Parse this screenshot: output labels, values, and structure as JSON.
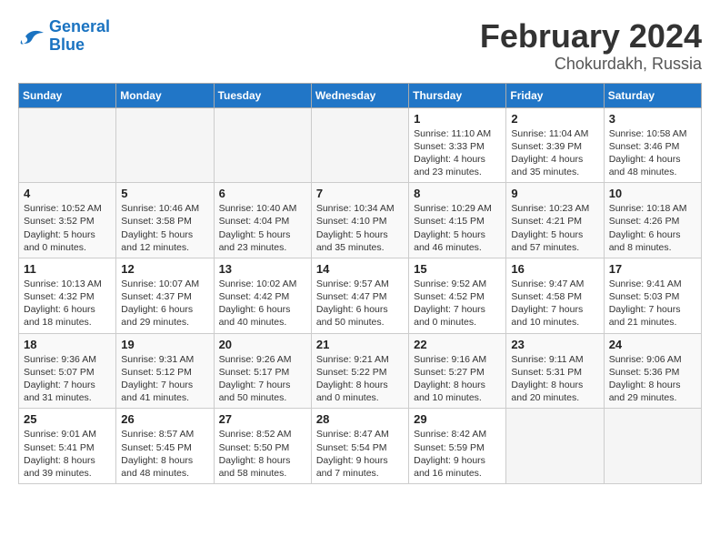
{
  "logo": {
    "line1": "General",
    "line2": "Blue"
  },
  "title": "February 2024",
  "location": "Chokurdakh, Russia",
  "weekdays": [
    "Sunday",
    "Monday",
    "Tuesday",
    "Wednesday",
    "Thursday",
    "Friday",
    "Saturday"
  ],
  "weeks": [
    [
      {
        "day": "",
        "info": ""
      },
      {
        "day": "",
        "info": ""
      },
      {
        "day": "",
        "info": ""
      },
      {
        "day": "",
        "info": ""
      },
      {
        "day": "1",
        "info": "Sunrise: 11:10 AM\nSunset: 3:33 PM\nDaylight: 4 hours\nand 23 minutes."
      },
      {
        "day": "2",
        "info": "Sunrise: 11:04 AM\nSunset: 3:39 PM\nDaylight: 4 hours\nand 35 minutes."
      },
      {
        "day": "3",
        "info": "Sunrise: 10:58 AM\nSunset: 3:46 PM\nDaylight: 4 hours\nand 48 minutes."
      }
    ],
    [
      {
        "day": "4",
        "info": "Sunrise: 10:52 AM\nSunset: 3:52 PM\nDaylight: 5 hours\nand 0 minutes."
      },
      {
        "day": "5",
        "info": "Sunrise: 10:46 AM\nSunset: 3:58 PM\nDaylight: 5 hours\nand 12 minutes."
      },
      {
        "day": "6",
        "info": "Sunrise: 10:40 AM\nSunset: 4:04 PM\nDaylight: 5 hours\nand 23 minutes."
      },
      {
        "day": "7",
        "info": "Sunrise: 10:34 AM\nSunset: 4:10 PM\nDaylight: 5 hours\nand 35 minutes."
      },
      {
        "day": "8",
        "info": "Sunrise: 10:29 AM\nSunset: 4:15 PM\nDaylight: 5 hours\nand 46 minutes."
      },
      {
        "day": "9",
        "info": "Sunrise: 10:23 AM\nSunset: 4:21 PM\nDaylight: 5 hours\nand 57 minutes."
      },
      {
        "day": "10",
        "info": "Sunrise: 10:18 AM\nSunset: 4:26 PM\nDaylight: 6 hours\nand 8 minutes."
      }
    ],
    [
      {
        "day": "11",
        "info": "Sunrise: 10:13 AM\nSunset: 4:32 PM\nDaylight: 6 hours\nand 18 minutes."
      },
      {
        "day": "12",
        "info": "Sunrise: 10:07 AM\nSunset: 4:37 PM\nDaylight: 6 hours\nand 29 minutes."
      },
      {
        "day": "13",
        "info": "Sunrise: 10:02 AM\nSunset: 4:42 PM\nDaylight: 6 hours\nand 40 minutes."
      },
      {
        "day": "14",
        "info": "Sunrise: 9:57 AM\nSunset: 4:47 PM\nDaylight: 6 hours\nand 50 minutes."
      },
      {
        "day": "15",
        "info": "Sunrise: 9:52 AM\nSunset: 4:52 PM\nDaylight: 7 hours\nand 0 minutes."
      },
      {
        "day": "16",
        "info": "Sunrise: 9:47 AM\nSunset: 4:58 PM\nDaylight: 7 hours\nand 10 minutes."
      },
      {
        "day": "17",
        "info": "Sunrise: 9:41 AM\nSunset: 5:03 PM\nDaylight: 7 hours\nand 21 minutes."
      }
    ],
    [
      {
        "day": "18",
        "info": "Sunrise: 9:36 AM\nSunset: 5:07 PM\nDaylight: 7 hours\nand 31 minutes."
      },
      {
        "day": "19",
        "info": "Sunrise: 9:31 AM\nSunset: 5:12 PM\nDaylight: 7 hours\nand 41 minutes."
      },
      {
        "day": "20",
        "info": "Sunrise: 9:26 AM\nSunset: 5:17 PM\nDaylight: 7 hours\nand 50 minutes."
      },
      {
        "day": "21",
        "info": "Sunrise: 9:21 AM\nSunset: 5:22 PM\nDaylight: 8 hours\nand 0 minutes."
      },
      {
        "day": "22",
        "info": "Sunrise: 9:16 AM\nSunset: 5:27 PM\nDaylight: 8 hours\nand 10 minutes."
      },
      {
        "day": "23",
        "info": "Sunrise: 9:11 AM\nSunset: 5:31 PM\nDaylight: 8 hours\nand 20 minutes."
      },
      {
        "day": "24",
        "info": "Sunrise: 9:06 AM\nSunset: 5:36 PM\nDaylight: 8 hours\nand 29 minutes."
      }
    ],
    [
      {
        "day": "25",
        "info": "Sunrise: 9:01 AM\nSunset: 5:41 PM\nDaylight: 8 hours\nand 39 minutes."
      },
      {
        "day": "26",
        "info": "Sunrise: 8:57 AM\nSunset: 5:45 PM\nDaylight: 8 hours\nand 48 minutes."
      },
      {
        "day": "27",
        "info": "Sunrise: 8:52 AM\nSunset: 5:50 PM\nDaylight: 8 hours\nand 58 minutes."
      },
      {
        "day": "28",
        "info": "Sunrise: 8:47 AM\nSunset: 5:54 PM\nDaylight: 9 hours\nand 7 minutes."
      },
      {
        "day": "29",
        "info": "Sunrise: 8:42 AM\nSunset: 5:59 PM\nDaylight: 9 hours\nand 16 minutes."
      },
      {
        "day": "",
        "info": ""
      },
      {
        "day": "",
        "info": ""
      }
    ]
  ]
}
